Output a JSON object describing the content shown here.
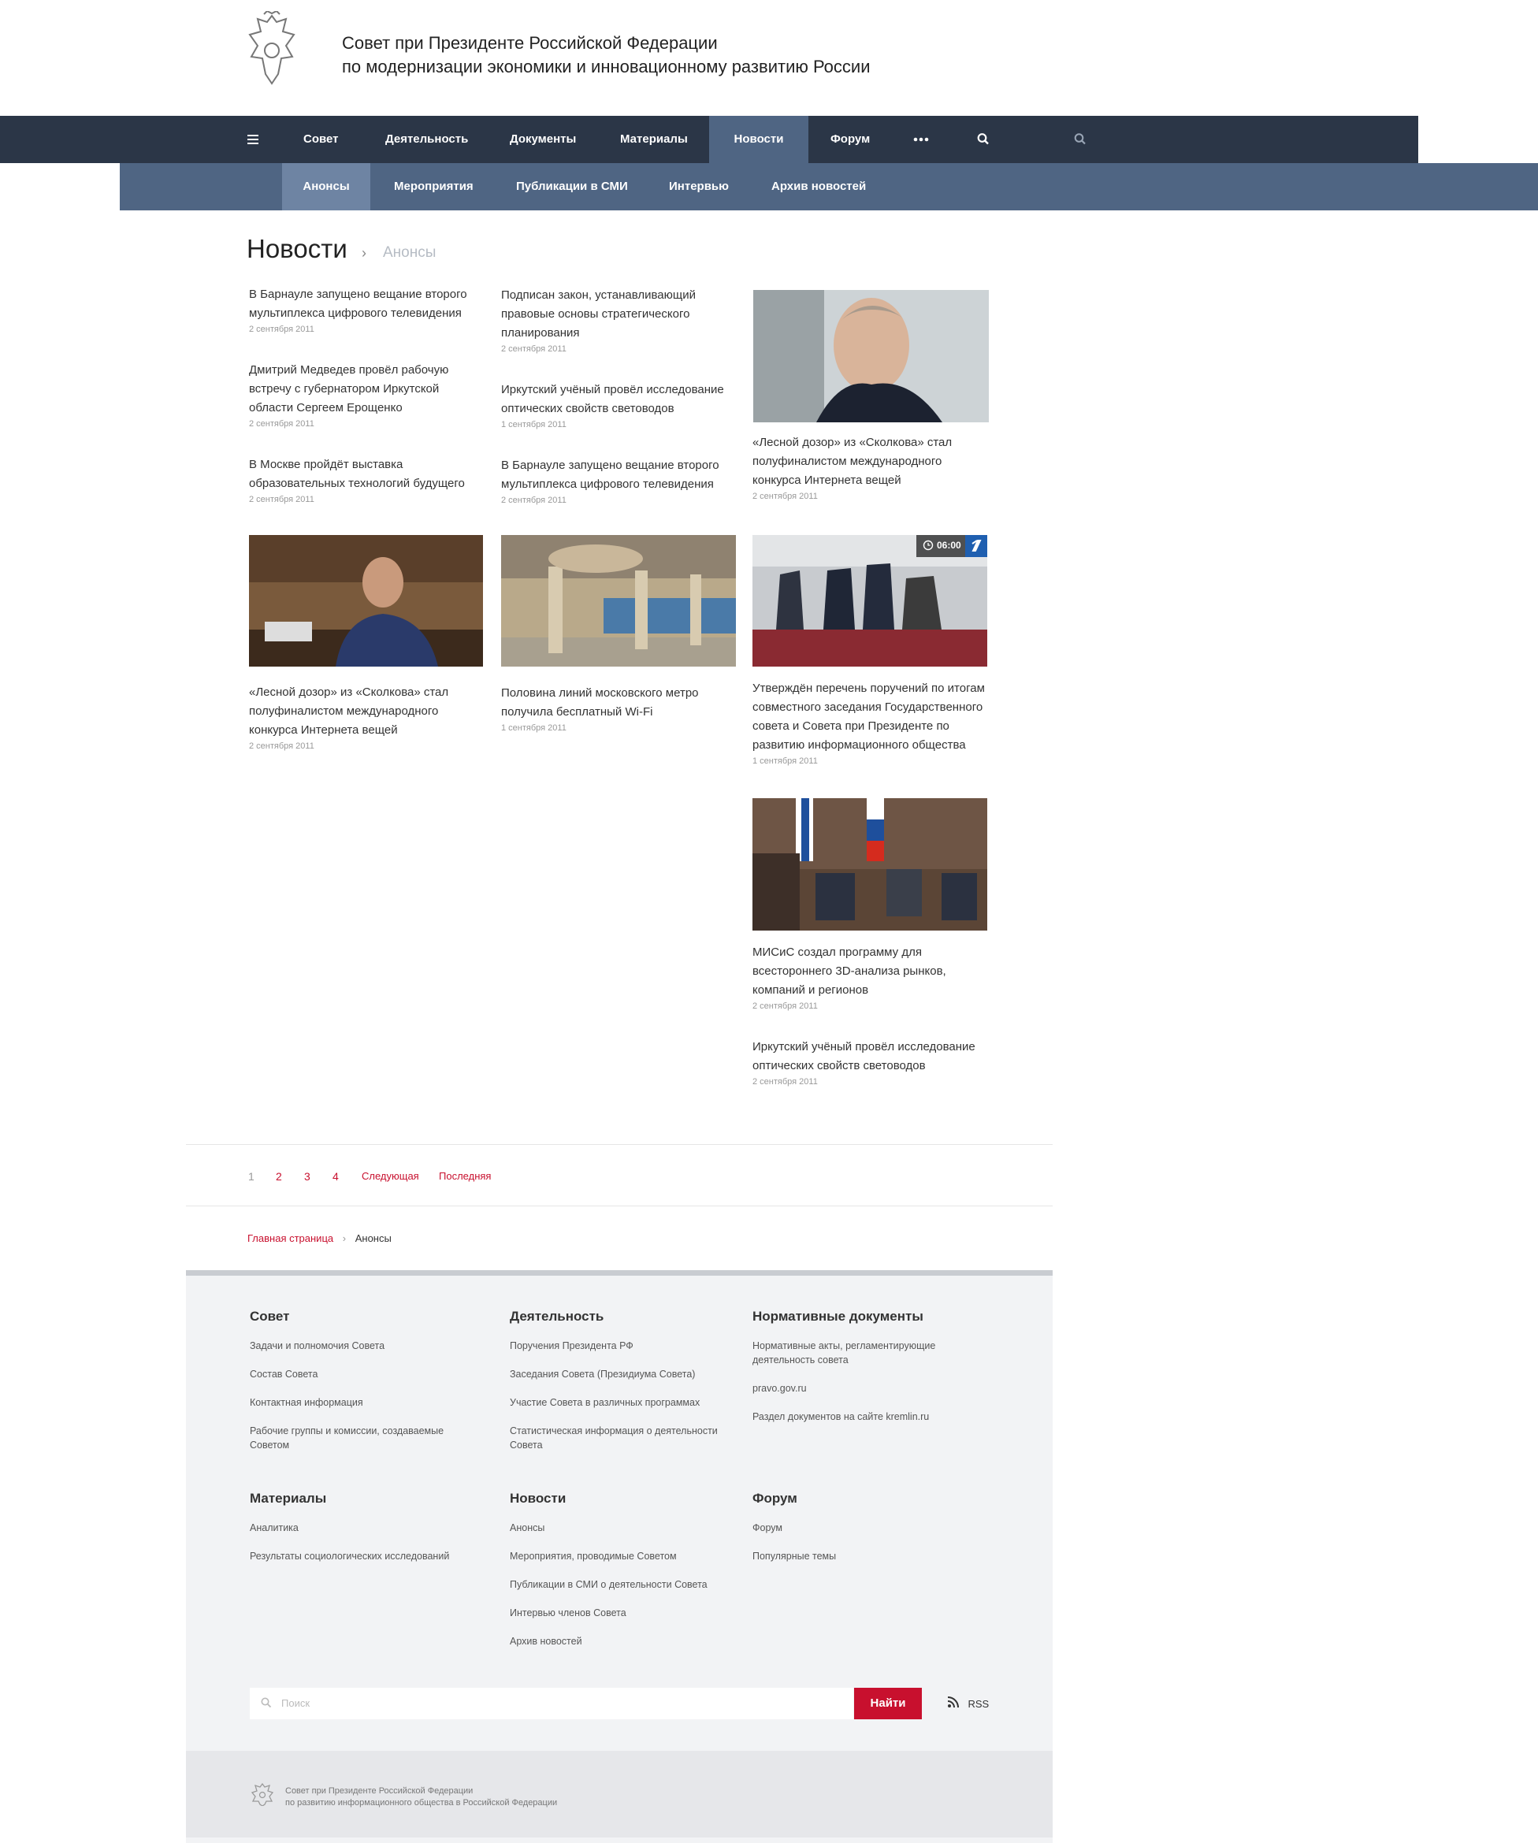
{
  "header": {
    "title_line1": "Совет при Президенте Российской Федерации",
    "title_line2": "по модернизации экономики и инновационному развитию России"
  },
  "topnav": {
    "items": [
      "Совет",
      "Деятельность",
      "Документы",
      "Материалы",
      "Новости",
      "Форум"
    ],
    "active": "Новости"
  },
  "subnav": {
    "items": [
      "Анонсы",
      "Мероприятия",
      "Публикации в СМИ",
      "Интервью",
      "Архив новостей"
    ],
    "active": "Анонсы"
  },
  "page": {
    "title": "Новости",
    "crumb_sep": "›",
    "crumb_current": "Анонсы"
  },
  "news": [
    {
      "title": "В Барнауле запущено вещание второго мультиплекса цифрового телевидения",
      "date": "2 сентября 2011"
    },
    {
      "title": "Дмитрий Медведев провёл рабочую встречу с губернатором Иркутской области Сергеем Ерощенко",
      "date": "2 сентября 2011"
    },
    {
      "title": "В Москве пройдёт выставка образовательных технологий будущего",
      "date": "2 сентября 2011"
    },
    {
      "title": "Подписан закон, устанавливающий правовые основы стратегического планирования",
      "date": "2 сентября 2011"
    },
    {
      "title": "Иркутский учёный провёл исследование оптических свойств световодов",
      "date": "1 сентября 2011"
    },
    {
      "title": "В Барнауле запущено вещание второго мультиплекса цифрового телевидения",
      "date": "2 сентября 2011"
    },
    {
      "title": "«Лесной дозор» из «Сколкова» стал полуфиналистом международного конкурса Интернета вещей",
      "date": "2 сентября 2011"
    },
    {
      "title": "«Лесной дозор» из «Сколкова» стал полуфиналистом международного конкурса Интернета вещей",
      "date": "2 сентября 2011"
    },
    {
      "title": "Половина линий московского метро получила бесплатный Wi-Fi",
      "date": "1 сентября 2011"
    },
    {
      "title": "Утверждён перечень поручений по итогам совместного заседания Государственного совета и Совета при Президенте по развитию информационного общества",
      "date": "1 сентября 2011"
    },
    {
      "title": "МИСиС создал программу для всестороннего 3D-анализа рынков, компаний и регионов",
      "date": "2 сентября 2011"
    },
    {
      "title": "Иркутский учёный провёл исследование оптических свойств световодов",
      "date": "2 сентября 2011"
    }
  ],
  "video_badge": {
    "duration": "06:00"
  },
  "pagination": {
    "pages": [
      "1",
      "2",
      "3",
      "4"
    ],
    "next": "Следующая",
    "last": "Последняя",
    "current": "1"
  },
  "breadcrumb": {
    "home": "Главная страница",
    "sep": "›",
    "current": "Анонсы"
  },
  "footer": {
    "cols": [
      {
        "heading": "Совет",
        "links": [
          "Задачи и полномочия Совета",
          "Состав Совета",
          "Контактная информация",
          "Рабочие группы и комиссии, создаваемые Советом"
        ]
      },
      {
        "heading": "Деятельность",
        "links": [
          "Поручения Президента РФ",
          "Заседания Совета (Президиума Совета)",
          "Участие Совета в различных программах",
          "Статистическая информация о деятельности Совета"
        ]
      },
      {
        "heading": "Нормативные документы",
        "links": [
          "Нормативные акты, регламентирующие деятельность совета",
          "pravo.gov.ru",
          "Раздел документов на сайте kremlin.ru"
        ]
      },
      {
        "heading": "Материалы",
        "links": [
          "Аналитика",
          "Результаты социологических исследований"
        ]
      },
      {
        "heading": "Новости",
        "links": [
          "Анонсы",
          "Мероприятия, проводимые Советом",
          "Публикации в СМИ о деятельности Совета",
          "Интервью членов Совета",
          "Архив новостей"
        ]
      },
      {
        "heading": "Форум",
        "links": [
          "Форум",
          "Популярные темы"
        ]
      }
    ],
    "search": {
      "placeholder": "Поиск",
      "button": "Найти"
    },
    "rss": "RSS",
    "bottom_line1": "Совет при Президенте Российской Федерации",
    "bottom_line2": "по развитию информационного общества в Российской Федерации"
  },
  "colors": {
    "nav": "#2b3647",
    "subnav": "#4f6583",
    "accent": "#c8102e"
  }
}
